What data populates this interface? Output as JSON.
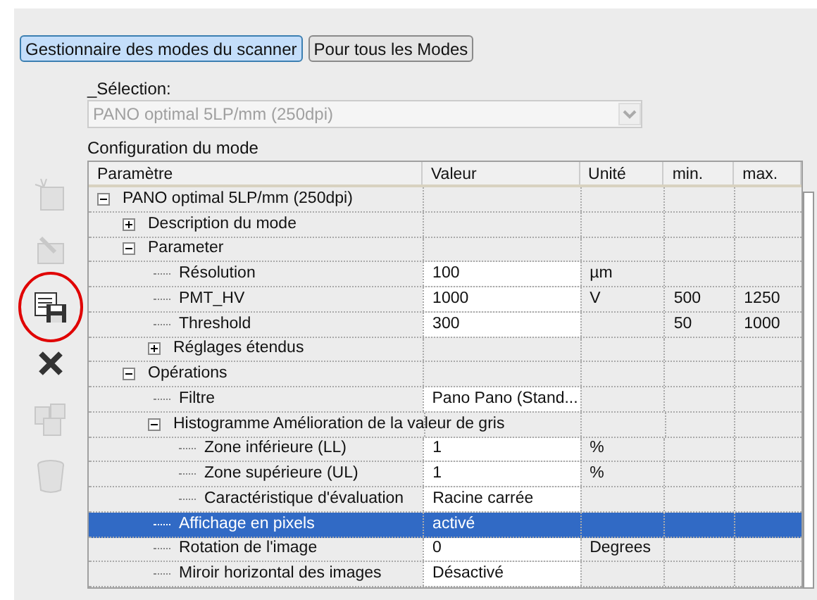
{
  "mode_buttons": [
    {
      "label": "Gestionnaire des modes du scanner",
      "selected": true
    },
    {
      "label": "Pour tous les Modes",
      "selected": false
    }
  ],
  "selection": {
    "label": "_Sélection:",
    "value": "PANO optimal 5LP/mm (250dpi)",
    "disabled": true
  },
  "config_label": "Configuration du mode",
  "toolbar": [
    {
      "kind": "new",
      "disabled": true
    },
    {
      "kind": "copy",
      "disabled": true
    },
    {
      "kind": "save",
      "disabled": false,
      "circled": true
    },
    {
      "kind": "delete",
      "disabled": false,
      "circled": false
    },
    {
      "kind": "import",
      "disabled": true
    },
    {
      "kind": "trash",
      "disabled": true
    }
  ],
  "table": {
    "columns": [
      "Paramètre",
      "Valeur",
      "Unité",
      "min.",
      "max."
    ],
    "rows": [
      {
        "label": "PANO optimal 5LP/mm (250dpi)",
        "expanded": true,
        "children": [
          {
            "label": "Description du mode",
            "expanded": false
          },
          {
            "label": "Parameter",
            "expanded": true,
            "children": [
              {
                "label": "Résolution",
                "value": "100",
                "unit": "µm",
                "selected": false
              },
              {
                "label": "PMT_HV",
                "value": "1000",
                "unit": "V",
                "min": "500",
                "max": "1250",
                "selected": false
              },
              {
                "label": "Threshold",
                "value": "300",
                "min": "50",
                "max": "1000",
                "selected": false
              },
              {
                "label": "Réglages étendus",
                "expanded": false
              }
            ]
          },
          {
            "label": "Opérations",
            "expanded": true,
            "children": [
              {
                "label": "Filtre",
                "value": "Pano Pano (Stand...",
                "selected": false
              },
              {
                "label": "Histogramme Amélioration de la valeur de gris",
                "expanded": true,
                "children": [
                  {
                    "label": "Zone inférieure (LL)",
                    "value": "1",
                    "unit": "%",
                    "selected": false
                  },
                  {
                    "label": "Zone supérieure (UL)",
                    "value": "1",
                    "unit": "%",
                    "selected": false
                  },
                  {
                    "label": "Caractéristique d'évaluation",
                    "value": "Racine carrée",
                    "selected": false
                  }
                ]
              },
              {
                "label": "Affichage en pixels",
                "value": "activé",
                "selected": true
              },
              {
                "label": "Rotation de l'image",
                "value": "0",
                "unit": "Degrees",
                "selected": false
              },
              {
                "label": "Miroir horizontal des images",
                "value": "Désactivé",
                "selected": false
              }
            ]
          }
        ]
      }
    ]
  }
}
